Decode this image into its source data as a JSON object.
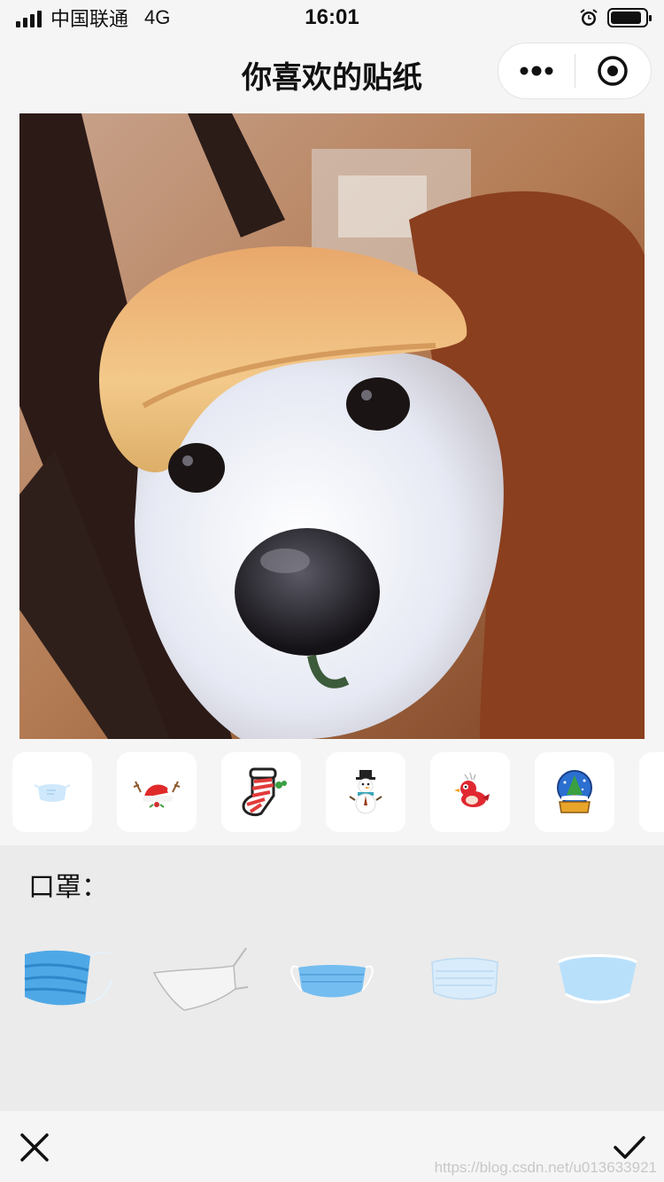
{
  "status_bar": {
    "carrier": "中国联通",
    "network": "4G",
    "time": "16:01",
    "battery_level": 0.9
  },
  "nav": {
    "title": "你喜欢的贴纸"
  },
  "photo": {
    "subject": "dog wearing bread hat"
  },
  "sticker_categories": [
    {
      "icon": "mask-icon"
    },
    {
      "icon": "christmas-hat-icon"
    },
    {
      "icon": "christmas-stocking-icon"
    },
    {
      "icon": "snowman-icon"
    },
    {
      "icon": "bird-icon"
    },
    {
      "icon": "snow-globe-icon"
    },
    {
      "icon": "gingerbread-icon"
    }
  ],
  "panel": {
    "label": "口罩："
  },
  "masks": [
    {
      "icon": "blue-mask-icon",
      "color": "#4fa8e6"
    },
    {
      "icon": "white-mask-icon",
      "color": "#f2f2f2"
    },
    {
      "icon": "blue-mask-icon",
      "color": "#74bdf0"
    },
    {
      "icon": "light-blue-mask-icon",
      "color": "#d9ecfb"
    },
    {
      "icon": "light-blue-mask-icon",
      "color": "#b9e0fb"
    },
    {
      "icon": "blue-mask-icon",
      "color": "#a9d7f4"
    },
    {
      "icon": "white-mask-icon",
      "color": "#ffffff"
    },
    {
      "icon": "pink-mask-icon",
      "color": "#f7c9cf"
    },
    {
      "icon": "blue-mask-icon",
      "color": "#6fbde9"
    }
  ],
  "bottom_bar": {
    "watermark": "https://blog.csdn.net/u013633921"
  },
  "colors": {
    "background": "#f5f5f5",
    "panel": "#ebebeb"
  }
}
